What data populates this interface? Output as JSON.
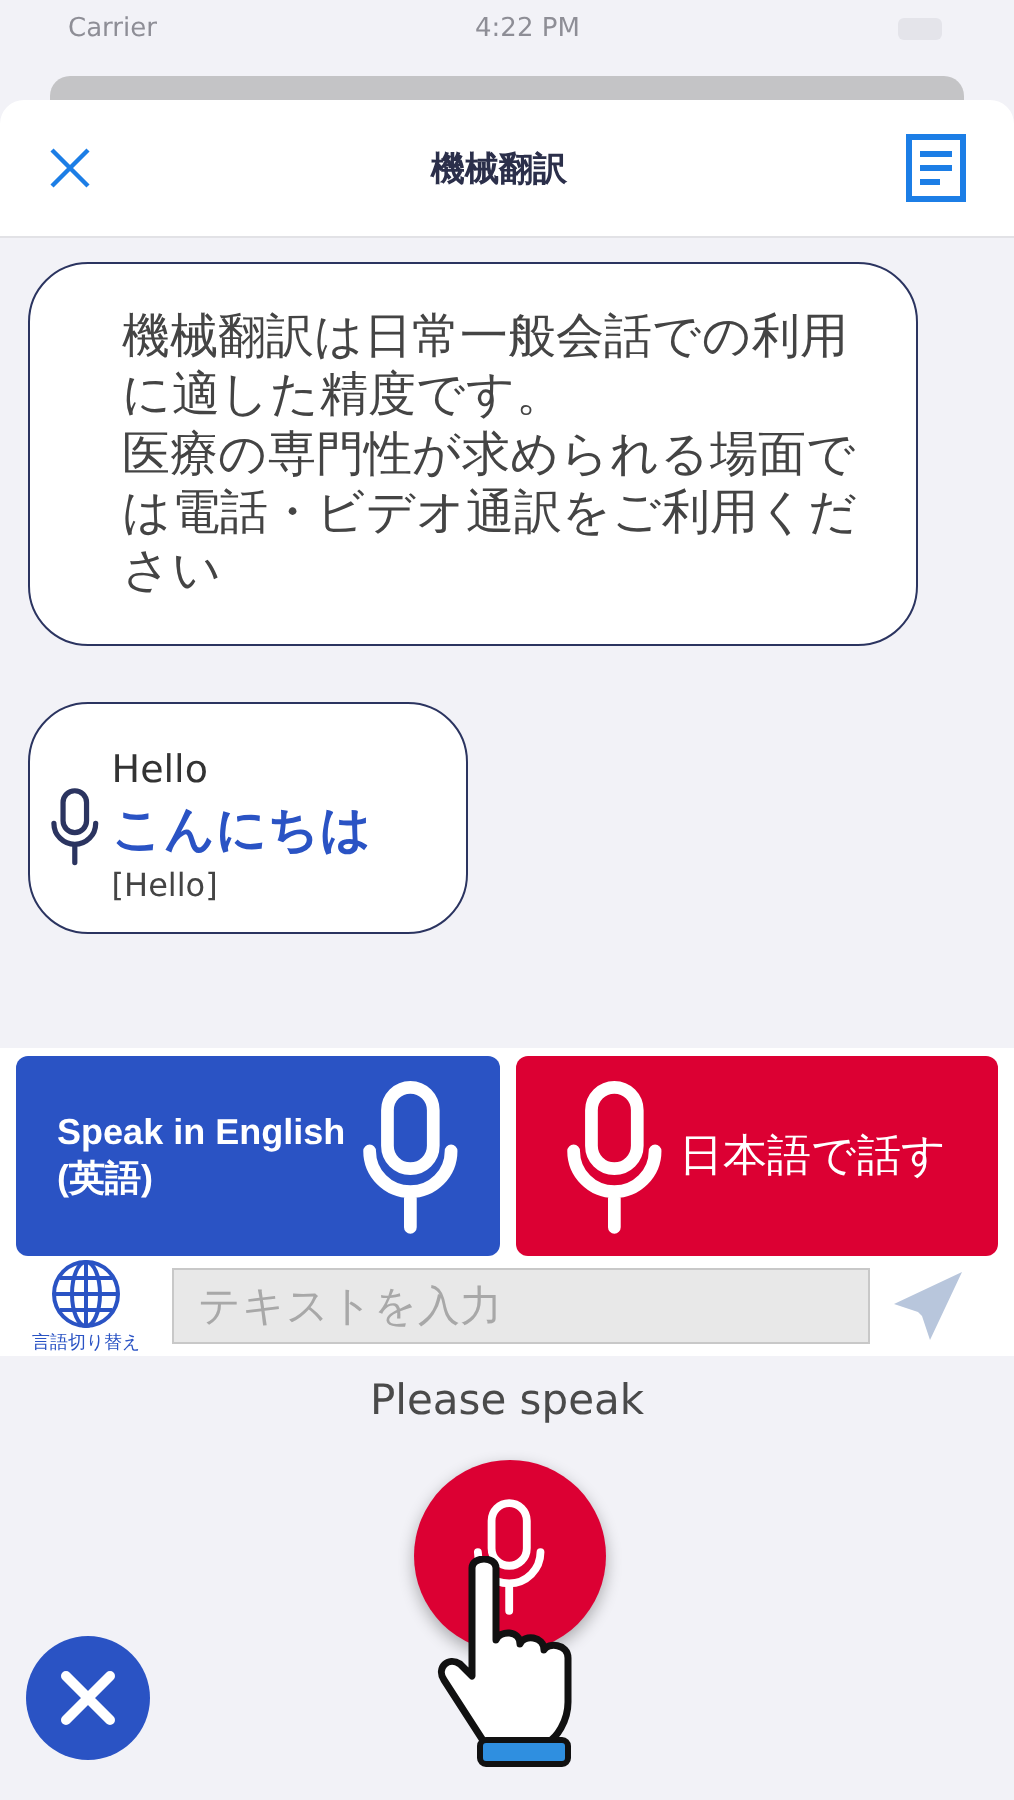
{
  "status_bar": {
    "carrier": "Carrier",
    "time": "4:22 PM"
  },
  "header": {
    "title": "機械翻訳"
  },
  "messages": [
    {
      "kind": "notice",
      "paragraphs": [
        "機械翻訳は日常一般会話での利用に適した精度です。",
        "医療の専門性が求められる場面では電話・ビデオ通訳をご利用ください"
      ]
    },
    {
      "kind": "speech",
      "source": "Hello",
      "translation": "こんにちは",
      "back_translation": "[Hello]"
    }
  ],
  "speak_buttons": [
    {
      "kind": "mic_after",
      "label": "Speak in English\n(英語)",
      "color": "#2a53c4"
    },
    {
      "kind": "mic_before",
      "label": "日本語で話す",
      "color": "#dc0033"
    }
  ],
  "input_bar": {
    "language_switch": "言語切り替え",
    "placeholder": "テキストを入力"
  },
  "prompt": "Please speak"
}
